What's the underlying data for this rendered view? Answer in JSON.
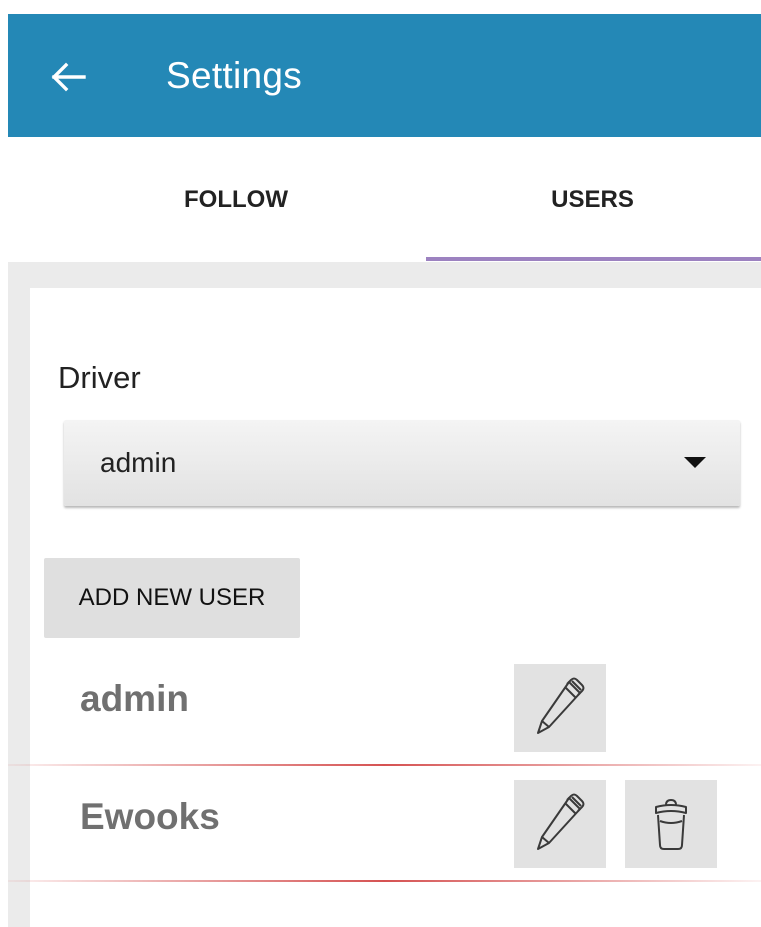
{
  "app_bar": {
    "title": "Settings",
    "back_icon": "arrow-left-icon",
    "background_color": "#2488b6"
  },
  "tabs": [
    {
      "label": "FOLLOW",
      "selected": false
    },
    {
      "label": "USERS",
      "selected": true
    }
  ],
  "tab_indicator_color": "#9c82c0",
  "driver": {
    "label": "Driver",
    "selected_value": "admin",
    "caret_icon": "caret-down-icon"
  },
  "add_user_button": {
    "label": "ADD NEW USER"
  },
  "users": [
    {
      "name": "admin",
      "actions": [
        "pencil-icon"
      ]
    },
    {
      "name": "Ewooks",
      "actions": [
        "pencil-icon",
        "trash-icon"
      ]
    }
  ]
}
